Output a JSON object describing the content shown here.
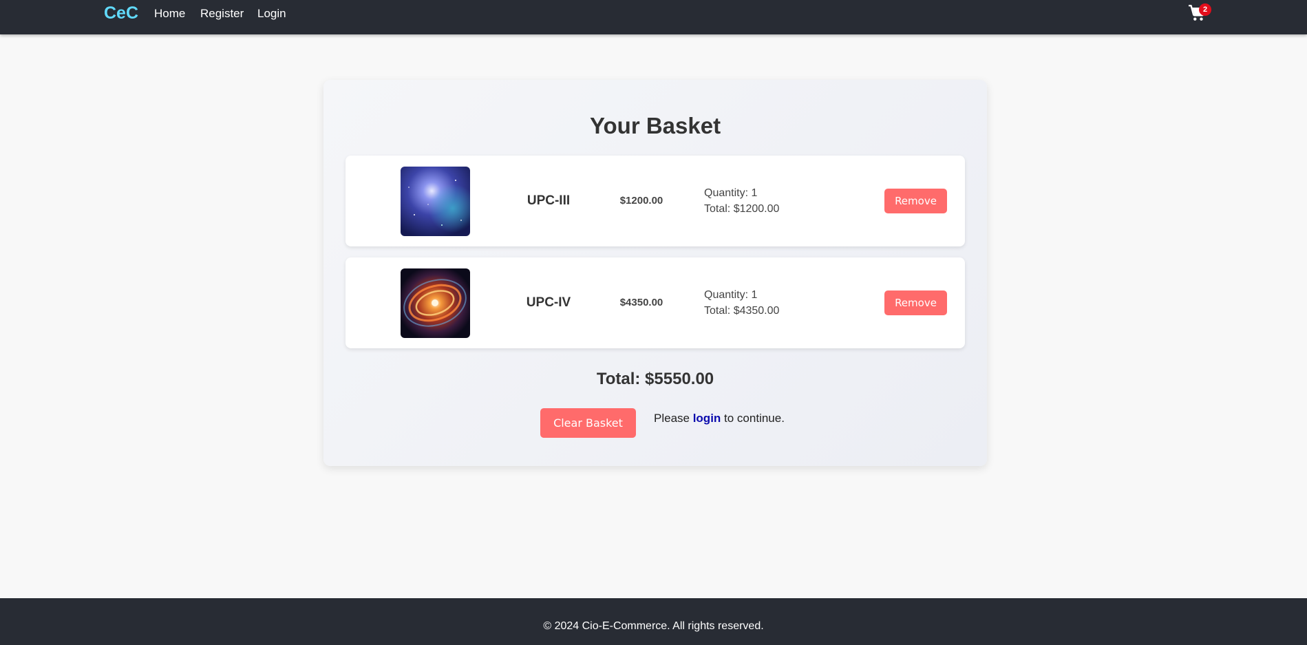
{
  "navbar": {
    "brand": "CeC",
    "links": [
      "Home",
      "Register",
      "Login"
    ],
    "cart_count": "2"
  },
  "basket": {
    "title": "Your Basket",
    "items": [
      {
        "name": "UPC-III",
        "price": "$1200.00",
        "quantity": "Quantity: 1",
        "total": "Total: $1200.00",
        "remove_label": "Remove",
        "image": "blue-nebula-thumbnail"
      },
      {
        "name": "UPC-IV",
        "price": "$4350.00",
        "quantity": "Quantity: 1",
        "total": "Total: $4350.00",
        "remove_label": "Remove",
        "image": "spiral-galaxy-thumbnail"
      }
    ],
    "grand_total": "Total: $5550.00",
    "clear_label": "Clear Basket",
    "login_prefix": "Please ",
    "login_link": "login",
    "login_suffix": " to continue."
  },
  "footer": {
    "text": "© 2024 Cio-E-Commerce. All rights reserved."
  },
  "colors": {
    "navbar_bg": "#282c34",
    "brand": "#61dafb",
    "button": "#ff6b6b",
    "badge": "#e20e1c",
    "link": "#0a0aad"
  }
}
